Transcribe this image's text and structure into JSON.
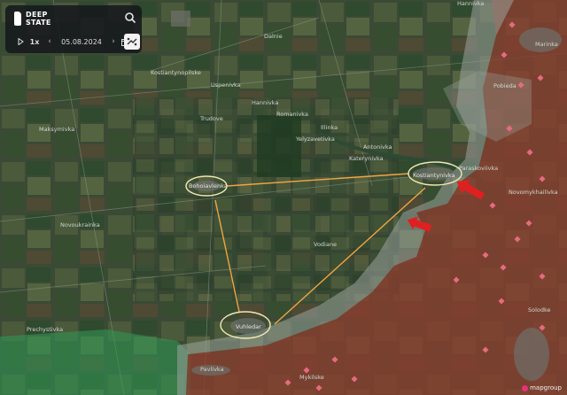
{
  "app": {
    "brand_line1": "DEEP",
    "brand_line2": "STATE",
    "speed": "1x",
    "date": "05.08.2024",
    "icons": [
      "search-icon",
      "play-icon",
      "chevron-left-icon",
      "chevron-right-icon",
      "calendar-icon",
      "layers-icon",
      "flag-marker-icon"
    ]
  },
  "map": {
    "places": {
      "dalnie": "Dalnie",
      "kostiantynopilske": "Kostiantynopilske",
      "uspenivka": "Uspenivka",
      "hannivka": "Hannivka",
      "romanivka": "Romanivka",
      "illinka": "Illinka",
      "trudove": "Trudove",
      "maksymivka": "Maksymivka",
      "yelyzavetivka": "Yelyzavetivka",
      "antonivka": "Antonivka",
      "katerynivka": "Katerynivka",
      "bohoiavlenka": "Bohoiavlenka",
      "kostiantynivka": "Kostiantynivka",
      "prechystivka": "Prechystivka",
      "novoukrainka": "Novoukrainka",
      "vodiane": "Vodiane",
      "vuhledar": "Vuhledar",
      "pavlivka": "Pavlivka",
      "mykilske": "Mykilske",
      "marinka": "Marinka",
      "pobieda": "Pobieda",
      "paraskoviivka": "Paraskoviivka",
      "novomykhailivka": "Novomykhailivka",
      "solodke": "Solodke",
      "hannivka_top": "Hannivka"
    },
    "colors": {
      "russian_controlled": "#8a3d30",
      "grey_zone": "#9aa29c",
      "liberated": "#2f9a55",
      "arrow": "#e02020",
      "connector": "#f2a541",
      "highlight_ellipse": "#f3e6b0",
      "flag_marker": "#e86a7f"
    },
    "flag_markers": 22
  },
  "watermark": "mapgroup"
}
